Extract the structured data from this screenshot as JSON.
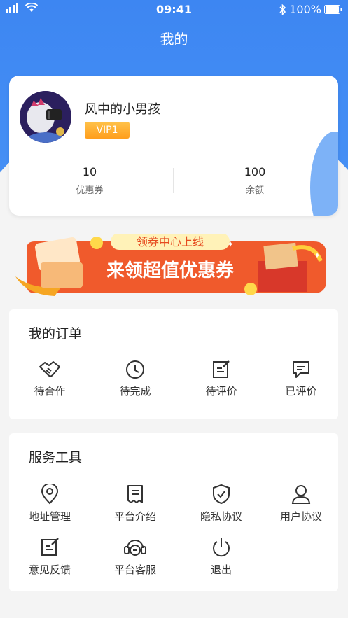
{
  "status": {
    "time": "09:41",
    "battery": "100%"
  },
  "page": {
    "title": "我的"
  },
  "profile": {
    "username": "风中的小男孩",
    "vip_label": "VIP1",
    "stats": [
      {
        "value": "10",
        "label": "优惠券"
      },
      {
        "value": "100",
        "label": "余额"
      }
    ]
  },
  "banner": {
    "tag": "领券中心上线",
    "headline": "来领超值优惠券"
  },
  "orders": {
    "title": "我的订单",
    "items": [
      {
        "label": "待合作",
        "icon": "handshake-icon"
      },
      {
        "label": "待完成",
        "icon": "clock-icon"
      },
      {
        "label": "待评价",
        "icon": "edit-note-icon"
      },
      {
        "label": "已评价",
        "icon": "comment-icon"
      }
    ]
  },
  "tools": {
    "title": "服务工具",
    "items": [
      {
        "label": "地址管理",
        "icon": "location-pin-icon"
      },
      {
        "label": "平台介绍",
        "icon": "receipt-icon"
      },
      {
        "label": "隐私协议",
        "icon": "shield-check-icon"
      },
      {
        "label": "用户协议",
        "icon": "user-icon"
      },
      {
        "label": "意见反馈",
        "icon": "feedback-edit-icon"
      },
      {
        "label": "平台客服",
        "icon": "headset-icon"
      },
      {
        "label": "退出",
        "icon": "power-icon"
      }
    ]
  },
  "colors": {
    "primary": "#3d86f2",
    "vip": "#ff9e1c",
    "banner": "#f05a2c"
  }
}
